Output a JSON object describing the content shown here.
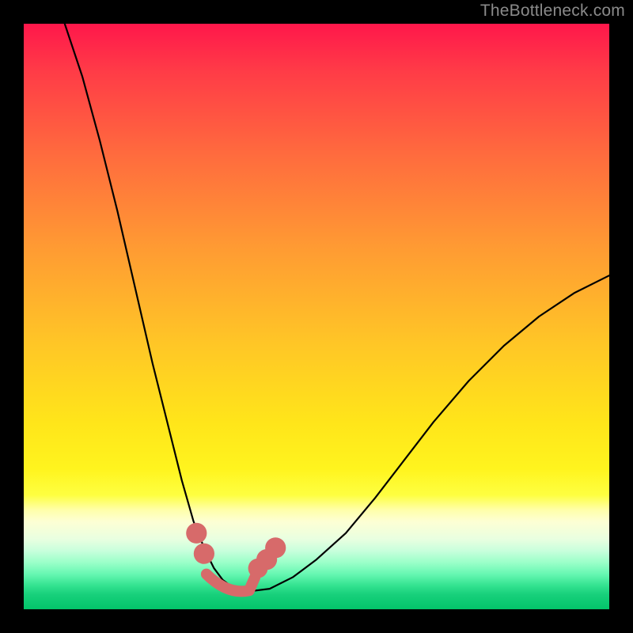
{
  "watermark": "TheBottleneck.com",
  "chart_data": {
    "type": "line",
    "title": "",
    "xlabel": "",
    "ylabel": "",
    "xlim": [
      0,
      100
    ],
    "ylim": [
      0,
      100
    ],
    "grid": false,
    "series": [
      {
        "name": "curve",
        "x": [
          7,
          10,
          13,
          16,
          19,
          22,
          25,
          27,
          29,
          31,
          32.5,
          34,
          36,
          38,
          42,
          46,
          50,
          55,
          60,
          65,
          70,
          76,
          82,
          88,
          94,
          100
        ],
        "y": [
          100,
          91,
          80,
          68,
          55,
          42,
          30,
          22,
          15,
          10,
          7,
          5,
          3.5,
          3,
          3.5,
          5.5,
          8.5,
          13,
          19,
          25.5,
          32,
          39,
          45,
          50,
          54,
          57
        ]
      }
    ],
    "markers": [
      {
        "x": 29.5,
        "y": 13,
        "r": 1.1
      },
      {
        "x": 30.8,
        "y": 9.5,
        "r": 1.1
      },
      {
        "x": 40.0,
        "y": 7.0,
        "r": 1.0
      },
      {
        "x": 41.5,
        "y": 8.5,
        "r": 1.1
      },
      {
        "x": 43.0,
        "y": 10.5,
        "r": 1.1
      }
    ],
    "trough_cap": {
      "x0": 31.2,
      "y0": 6.0,
      "x1": 38.5,
      "y1": 3.2,
      "x2": 39.5,
      "y2": 5.5
    },
    "background_gradient": {
      "top": "#ff174b",
      "mid": "#ffe51a",
      "bottom": "#03c46a"
    },
    "annotations": []
  }
}
